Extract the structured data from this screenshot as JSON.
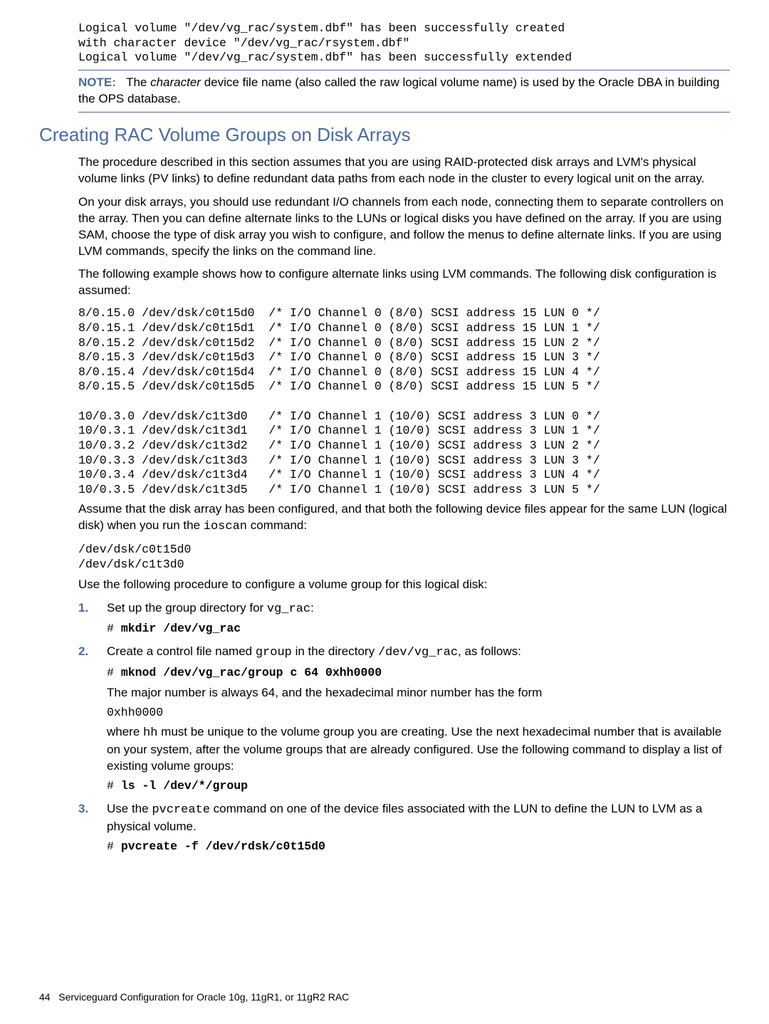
{
  "top_code": "Logical volume \"/dev/vg_rac/system.dbf\" has been successfully created\nwith character device \"/dev/vg_rac/rsystem.dbf\"\nLogical volume \"/dev/vg_rac/system.dbf\" has been successfully extended",
  "note": {
    "label": "NOTE:",
    "text_before": "The ",
    "italic": "character",
    "text_after": " device file name (also called the raw logical volume name) is used by the Oracle DBA in building the OPS database."
  },
  "heading": "Creating RAC Volume Groups on Disk Arrays",
  "para1": "The procedure described in this section assumes that you are using RAID-protected disk arrays and LVM's physical volume links (PV links) to define redundant data paths from each node in the cluster to every logical unit on the array.",
  "para2": "On your disk arrays, you should use redundant I/O channels from each node, connecting them to separate controllers on the array. Then you can define alternate links to the LUNs or logical disks you have defined on the array. If you are using SAM, choose the type of disk array you wish to configure, and follow the menus to define alternate links. If you are using LVM commands, specify the links on the command line.",
  "para3": "The following example shows how to configure alternate links using LVM commands. The following disk configuration is assumed:",
  "disk_config": "8/0.15.0 /dev/dsk/c0t15d0  /* I/O Channel 0 (8/0) SCSI address 15 LUN 0 */\n8/0.15.1 /dev/dsk/c0t15d1  /* I/O Channel 0 (8/0) SCSI address 15 LUN 1 */\n8/0.15.2 /dev/dsk/c0t15d2  /* I/O Channel 0 (8/0) SCSI address 15 LUN 2 */\n8/0.15.3 /dev/dsk/c0t15d3  /* I/O Channel 0 (8/0) SCSI address 15 LUN 3 */\n8/0.15.4 /dev/dsk/c0t15d4  /* I/O Channel 0 (8/0) SCSI address 15 LUN 4 */\n8/0.15.5 /dev/dsk/c0t15d5  /* I/O Channel 0 (8/0) SCSI address 15 LUN 5 */\n\n10/0.3.0 /dev/dsk/c1t3d0   /* I/O Channel 1 (10/0) SCSI address 3 LUN 0 */\n10/0.3.1 /dev/dsk/c1t3d1   /* I/O Channel 1 (10/0) SCSI address 3 LUN 1 */\n10/0.3.2 /dev/dsk/c1t3d2   /* I/O Channel 1 (10/0) SCSI address 3 LUN 2 */\n10/0.3.3 /dev/dsk/c1t3d3   /* I/O Channel 1 (10/0) SCSI address 3 LUN 3 */\n10/0.3.4 /dev/dsk/c1t3d4   /* I/O Channel 1 (10/0) SCSI address 3 LUN 4 */\n10/0.3.5 /dev/dsk/c1t3d5   /* I/O Channel 1 (10/0) SCSI address 3 LUN 5 */",
  "para4_before": "Assume that the disk array has been configured, and that both the following device files appear for the same LUN (logical disk) when you run the ",
  "para4_code": "ioscan",
  "para4_after": " command:",
  "dev_files": "/dev/dsk/c0t15d0\n/dev/dsk/c1t3d0",
  "para5": "Use the following procedure to configure a volume group for this logical disk:",
  "steps": {
    "s1": {
      "num": "1.",
      "text_before": "Set up the group directory for ",
      "code": "vg_rac",
      "text_after": ":",
      "cmd_prefix": "# ",
      "cmd": "mkdir /dev/vg_rac"
    },
    "s2": {
      "num": "2.",
      "t1": "Create a control file named ",
      "c1": "group",
      "t2": " in the directory ",
      "c2": "/dev/vg_rac",
      "t3": ", as follows:",
      "cmd_prefix": "# ",
      "cmd": "mknod /dev/vg_rac/group c 64 0xhh0000",
      "p2": "The major number is always 64, and the hexadecimal minor number has the form",
      "p2code": "0xhh0000",
      "p3a": "where ",
      "p3code": "hh",
      "p3b": " must be unique to the volume group you are creating. Use the next hexadecimal number that is available on your system, after the volume groups that are already configured. Use the following command to display a list of existing volume groups:",
      "cmd2_prefix": "# ",
      "cmd2": "ls -l /dev/*/group"
    },
    "s3": {
      "num": "3.",
      "t1": "Use the ",
      "c1": "pvcreate",
      "t2": " command on one of the device files associated with the LUN to define the LUN to LVM as a physical volume.",
      "cmd_prefix": "# ",
      "cmd": "pvcreate -f /dev/rdsk/c0t15d0"
    }
  },
  "footer": {
    "page": "44",
    "title": "Serviceguard Configuration for Oracle 10g, 11gR1, or 11gR2 RAC"
  }
}
